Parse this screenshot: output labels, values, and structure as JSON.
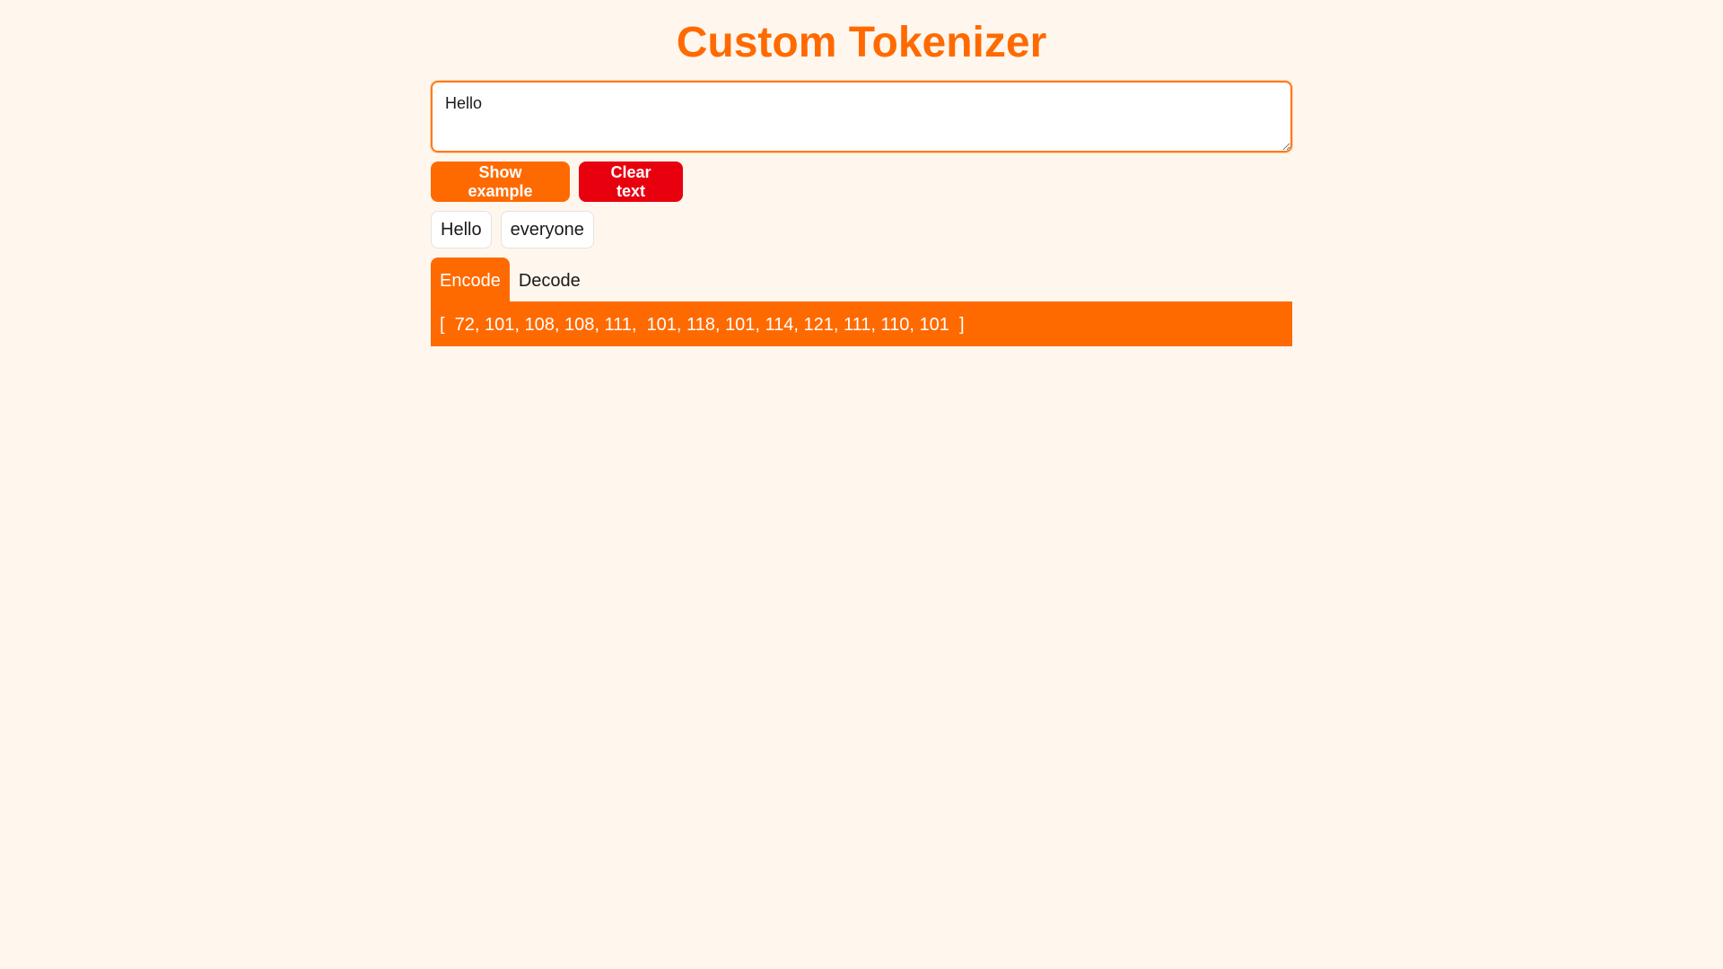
{
  "header": {
    "title": "Custom Tokenizer"
  },
  "input": {
    "value": "Hello"
  },
  "buttons": {
    "show_example": "Show example",
    "clear_text": "Clear text"
  },
  "tokens": [
    "Hello",
    "everyone"
  ],
  "tabs": [
    {
      "label": "Encode",
      "active": true
    },
    {
      "label": "Decode",
      "active": false
    }
  ],
  "output": {
    "text": "[  72, 101, 108, 108, 111,  101, 118, 101, 114, 121, 111, 110, 101  ]"
  },
  "colors": {
    "accent": "#ff6a00",
    "danger": "#e8000f",
    "background": "#fff7ee"
  }
}
